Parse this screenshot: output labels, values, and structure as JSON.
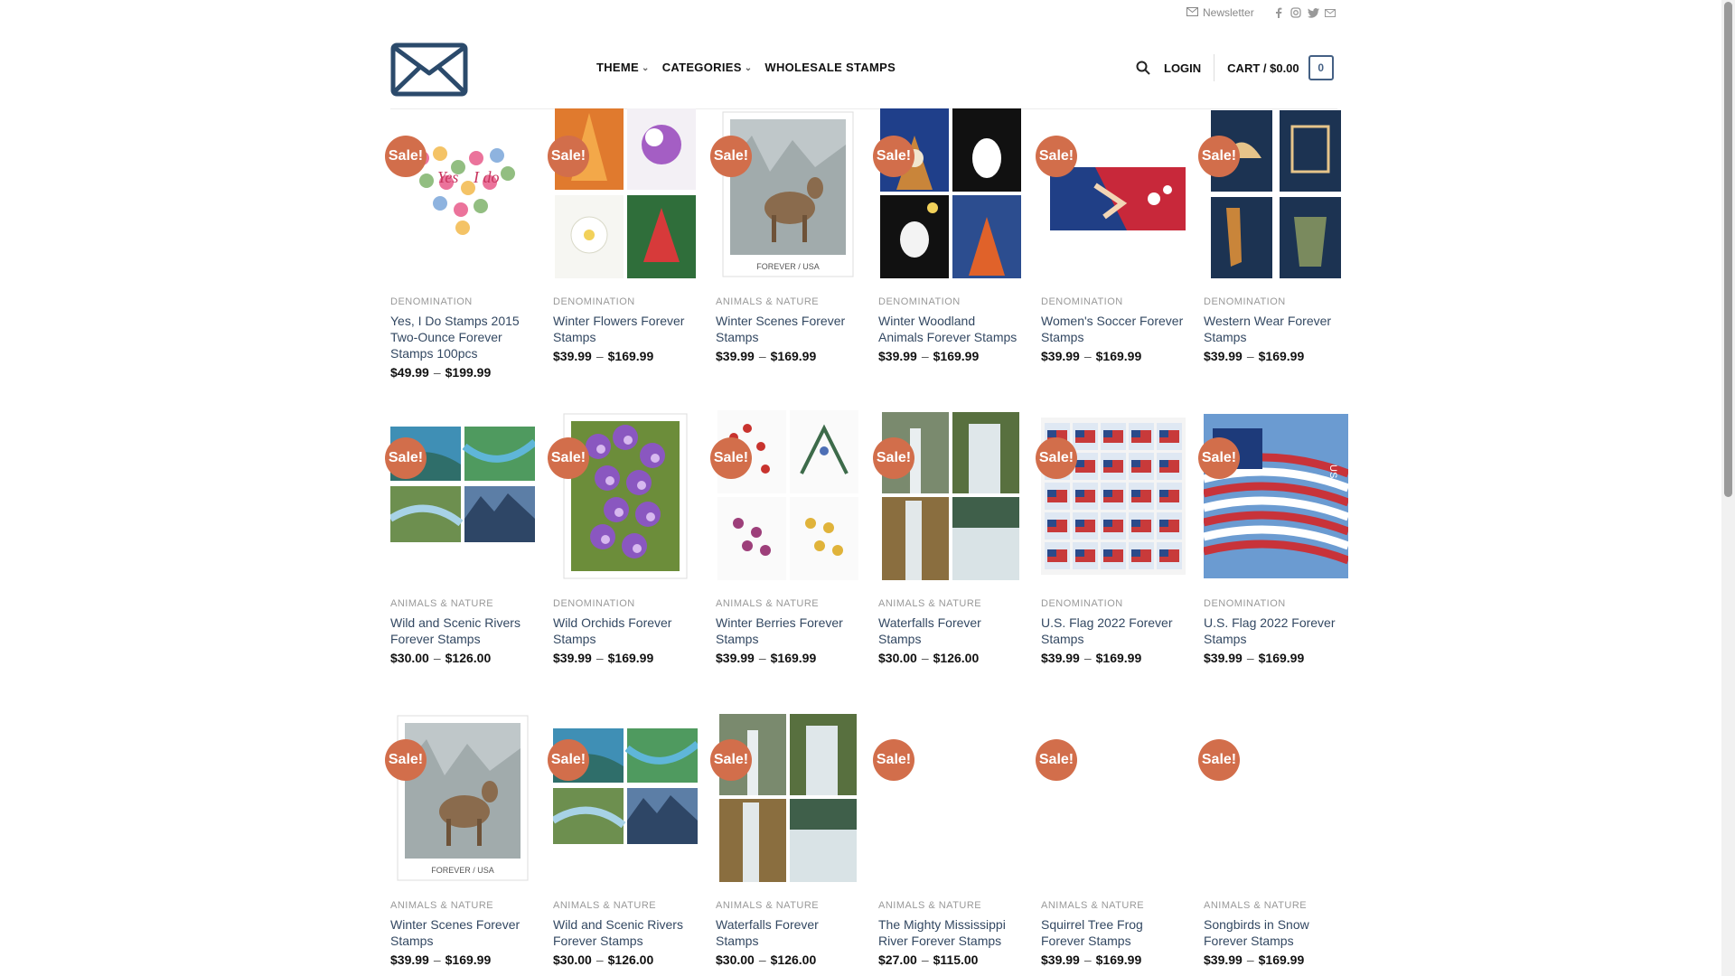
{
  "topbar": {
    "newsletter": "Newsletter",
    "socials": [
      "facebook-icon",
      "instagram-icon",
      "twitter-icon",
      "email-icon"
    ]
  },
  "header": {
    "nav": [
      {
        "label": "THEME",
        "dropdown": true
      },
      {
        "label": "CATEGORIES",
        "dropdown": true
      },
      {
        "label": "WHOLESALE STAMPS",
        "dropdown": false
      }
    ],
    "login": "LOGIN",
    "cart_label": "CART / $0.00",
    "cart_count": "0"
  },
  "colors": {
    "sale_badge": "#d26e4b",
    "link": "#334862",
    "cart_accent": "#446084"
  },
  "products": [
    {
      "sale": "Sale!",
      "category": "DENOMINATION",
      "title": "Yes, I Do Stamps 2015 Two-Ounce Forever Stamps 100pcs",
      "price_low": "$49.99",
      "price_high": "$199.99",
      "image": "yes-i-do"
    },
    {
      "sale": "Sale!",
      "category": "DENOMINATION",
      "title": "Winter Flowers Forever Stamps",
      "price_low": "$39.99",
      "price_high": "$169.99",
      "image": "winter-flowers"
    },
    {
      "sale": "Sale!",
      "category": "ANIMALS & NATURE",
      "title": "Winter Scenes Forever Stamps",
      "price_low": "$39.99",
      "price_high": "$169.99",
      "image": "deer"
    },
    {
      "sale": "Sale!",
      "category": "DENOMINATION",
      "title": "Winter Woodland Animals Forever Stamps",
      "price_low": "$39.99",
      "price_high": "$169.99",
      "image": "woodland"
    },
    {
      "sale": "Sale!",
      "category": "DENOMINATION",
      "title": "Women's Soccer Forever Stamps",
      "price_low": "$39.99",
      "price_high": "$169.99",
      "image": "soccer"
    },
    {
      "sale": "Sale!",
      "category": "DENOMINATION",
      "title": "Western Wear Forever Stamps",
      "price_low": "$39.99",
      "price_high": "$169.99",
      "image": "western"
    },
    {
      "sale": "Sale!",
      "category": "ANIMALS & NATURE",
      "title": "Wild and Scenic Rivers Forever Stamps",
      "price_low": "$30.00",
      "price_high": "$126.00",
      "image": "rivers"
    },
    {
      "sale": "Sale!",
      "category": "DENOMINATION",
      "title": "Wild Orchids Forever Stamps",
      "price_low": "$39.99",
      "price_high": "$169.99",
      "image": "orchids"
    },
    {
      "sale": "Sale!",
      "category": "ANIMALS & NATURE",
      "title": "Winter Berries Forever Stamps",
      "price_low": "$39.99",
      "price_high": "$169.99",
      "image": "berries"
    },
    {
      "sale": "Sale!",
      "category": "ANIMALS & NATURE",
      "title": "Waterfalls Forever Stamps",
      "price_low": "$30.00",
      "price_high": "$126.00",
      "image": "waterfalls"
    },
    {
      "sale": "Sale!",
      "category": "DENOMINATION",
      "title": "U.S. Flag 2022 Forever Stamps",
      "price_low": "$39.99",
      "price_high": "$169.99",
      "image": "flag-sheet"
    },
    {
      "sale": "Sale!",
      "category": "DENOMINATION",
      "title": "U.S. Flag 2022 Forever Stamps",
      "price_low": "$39.99",
      "price_high": "$169.99",
      "image": "flag"
    },
    {
      "sale": "Sale!",
      "category": "ANIMALS & NATURE",
      "title": "Winter Scenes Forever Stamps",
      "price_low": "$39.99",
      "price_high": "$169.99",
      "image": "deer"
    },
    {
      "sale": "Sale!",
      "category": "ANIMALS & NATURE",
      "title": "Wild and Scenic Rivers Forever Stamps",
      "price_low": "$30.00",
      "price_high": "$126.00",
      "image": "rivers"
    },
    {
      "sale": "Sale!",
      "category": "ANIMALS & NATURE",
      "title": "Waterfalls Forever Stamps",
      "price_low": "$30.00",
      "price_high": "$126.00",
      "image": "waterfalls"
    },
    {
      "sale": "Sale!",
      "category": "ANIMALS & NATURE",
      "title": "The Mighty Mississippi River Forever Stamps",
      "price_low": "$27.00",
      "price_high": "$115.00",
      "image": "blank"
    },
    {
      "sale": "Sale!",
      "category": "ANIMALS & NATURE",
      "title": "Squirrel Tree Frog Forever Stamps",
      "price_low": "$39.99",
      "price_high": "$169.99",
      "image": "blank"
    },
    {
      "sale": "Sale!",
      "category": "ANIMALS & NATURE",
      "title": "Songbirds in Snow Forever Stamps",
      "price_low": "$39.99",
      "price_high": "$169.99",
      "image": "blank"
    }
  ]
}
